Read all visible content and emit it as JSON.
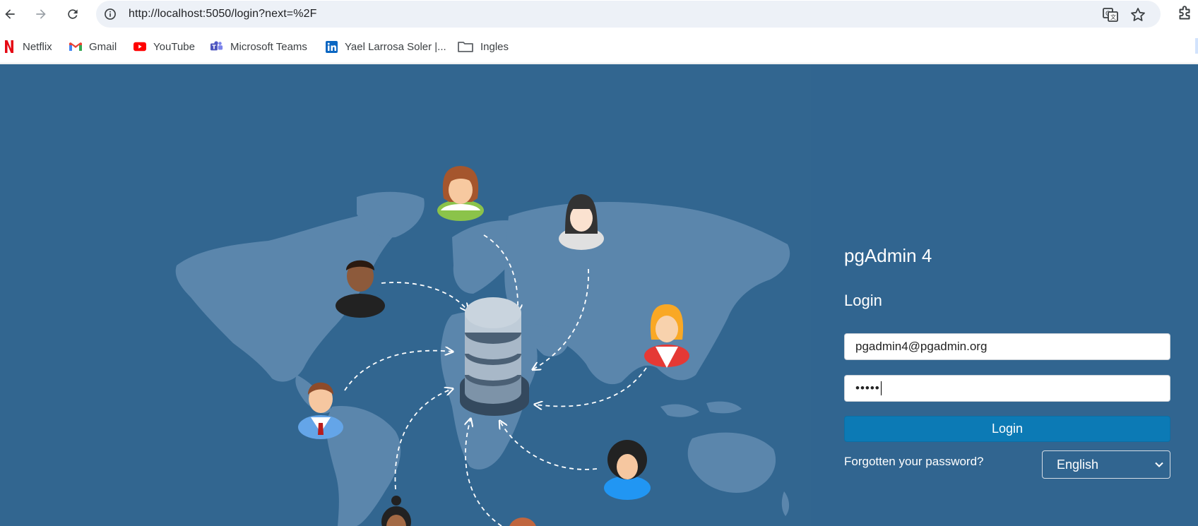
{
  "browser": {
    "url": "http://localhost:5050/login?next=%2F"
  },
  "bookmarks": [
    {
      "label": "Netflix",
      "icon": "netflix-icon"
    },
    {
      "label": "Gmail",
      "icon": "gmail-icon"
    },
    {
      "label": "YouTube",
      "icon": "youtube-icon"
    },
    {
      "label": "Microsoft Teams",
      "icon": "teams-icon"
    },
    {
      "label": "Yael Larrosa Soler |...",
      "icon": "linkedin-icon"
    },
    {
      "label": "Ingles",
      "icon": "folder-icon"
    }
  ],
  "login": {
    "app_title": "pgAdmin 4",
    "heading": "Login",
    "email_value": "pgadmin4@pgadmin.org",
    "password_mask": "•••••",
    "login_button": "Login",
    "forgot_password": "Forgotten your password?",
    "language": "English"
  },
  "colors": {
    "background": "#326690",
    "button": "#0c7ab5"
  }
}
